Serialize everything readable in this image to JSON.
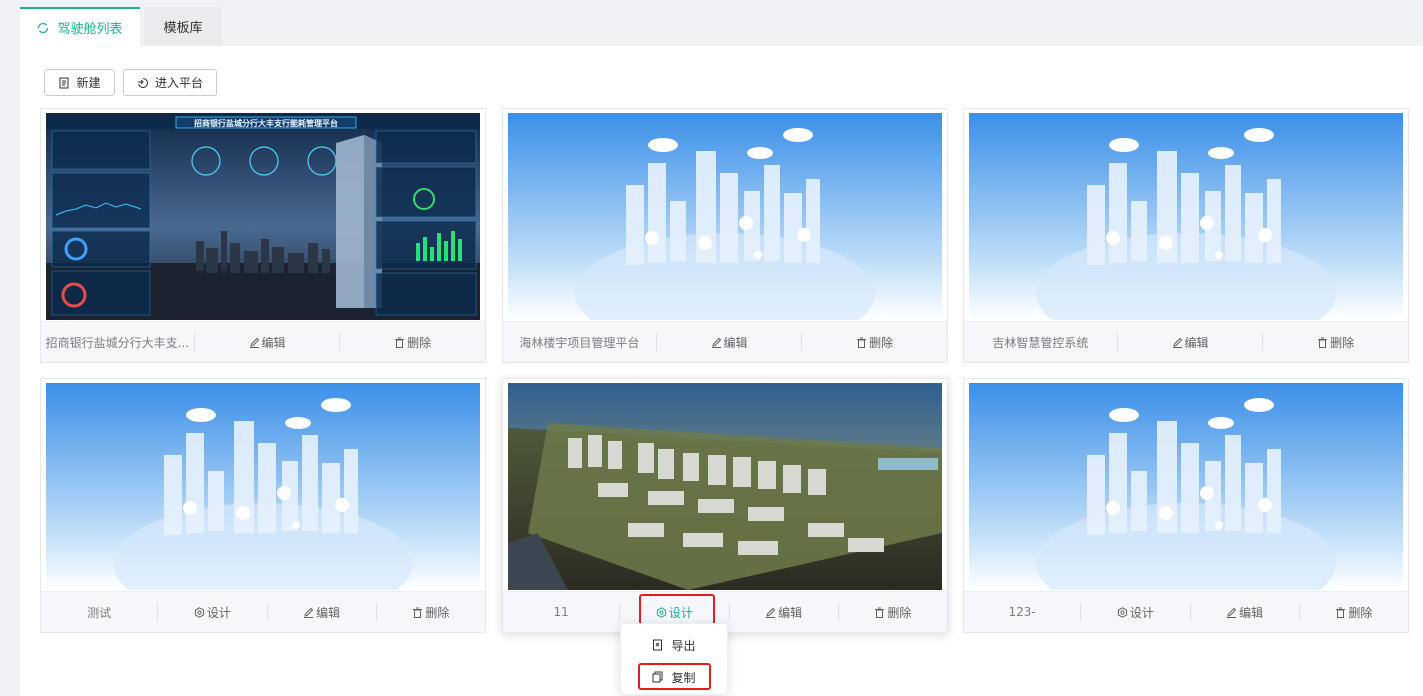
{
  "tabs": [
    {
      "label": "驾驶舱列表",
      "active": true
    },
    {
      "label": "模板库",
      "active": false
    }
  ],
  "toolbar": {
    "new_label": "新建",
    "enter_label": "进入平台"
  },
  "cards": [
    {
      "name": "招商银行盐城分行大丰支...",
      "design": null,
      "edit": "编辑",
      "delete": "删除",
      "thumb": "dashboard",
      "thumb_title": "招商银行盐城分行大丰支行能耗管理平台"
    },
    {
      "name": "海林楼宇项目管理平台",
      "design": null,
      "edit": "编辑",
      "delete": "删除",
      "thumb": "city"
    },
    {
      "name": "吉林智慧管控系统",
      "design": null,
      "edit": "编辑",
      "delete": "删除",
      "thumb": "city"
    },
    {
      "name": "测试",
      "design": "设计",
      "edit": "编辑",
      "delete": "删除",
      "thumb": "city"
    },
    {
      "name": "11",
      "design": "设计",
      "edit": "编辑",
      "delete": "删除",
      "thumb": "model"
    },
    {
      "name": "123-",
      "design": "设计",
      "edit": "编辑",
      "delete": "删除",
      "thumb": "city"
    }
  ],
  "dropdown": {
    "export_label": "导出",
    "copy_label": "复制"
  },
  "colors": {
    "accent": "#1ab394",
    "highlight_box": "#e02020",
    "sky_top": "#3b8fe8",
    "sky_bottom": "#ffffff"
  },
  "icons": {
    "tab_active": "refresh-icon",
    "new": "document-icon",
    "enter": "enter-icon",
    "design": "gear-icon",
    "edit": "pencil-icon",
    "delete": "trash-icon",
    "export": "export-file-icon",
    "copy": "copy-icon"
  }
}
